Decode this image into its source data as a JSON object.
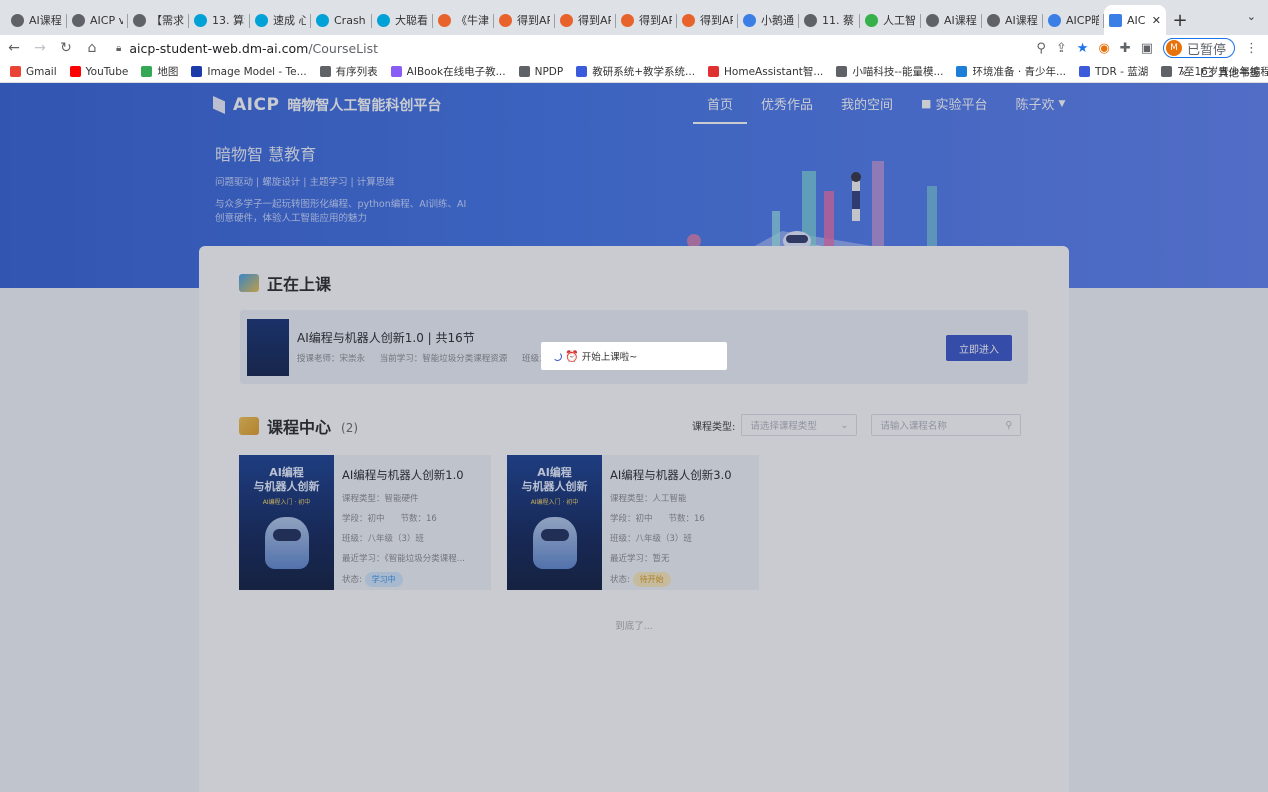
{
  "browser": {
    "tabs": [
      {
        "label": "AI课程",
        "color": "#5f6368"
      },
      {
        "label": "AICP v",
        "color": "#5f6368"
      },
      {
        "label": "【需求",
        "color": "#5f6368"
      },
      {
        "label": "13. 算法",
        "color": "#00a1d6"
      },
      {
        "label": "速成 心",
        "color": "#00a1d6"
      },
      {
        "label": "Crash C",
        "color": "#00a1d6"
      },
      {
        "label": "大聪看",
        "color": "#00a1d6"
      },
      {
        "label": "《牛津",
        "color": "#e8632c"
      },
      {
        "label": "得到AP",
        "color": "#e8632c"
      },
      {
        "label": "得到AP",
        "color": "#e8632c"
      },
      {
        "label": "得到AP",
        "color": "#e8632c"
      },
      {
        "label": "得到AP",
        "color": "#e8632c"
      },
      {
        "label": "小鹅通",
        "color": "#3b7ee6"
      },
      {
        "label": "11. 蔡",
        "color": "#5f6368"
      },
      {
        "label": "人工智",
        "color": "#35b04a"
      },
      {
        "label": "AI课程",
        "color": "#5f6368"
      },
      {
        "label": "AI课程",
        "color": "#5f6368"
      },
      {
        "label": "AICP暗",
        "color": "#3b7ee6"
      }
    ],
    "active_tab": {
      "label": "AIC",
      "close": "✕"
    },
    "new_tab": "+",
    "tab_menu": "⌄",
    "url_host": "aicp-student-web.dm-ai.com",
    "url_path": "/CourseList",
    "profile_initial": "M",
    "profile_label": "已暂停",
    "bookmarks": [
      {
        "label": "Gmail",
        "color": "#ea4335"
      },
      {
        "label": "YouTube",
        "color": "#ff0000"
      },
      {
        "label": "地图",
        "color": "#34a853"
      },
      {
        "label": "Image Model - Te...",
        "color": "#1a3ba8"
      },
      {
        "label": "有序列表",
        "color": "#5f6368"
      },
      {
        "label": "AIBook在线电子教...",
        "color": "#8a5cf6"
      },
      {
        "label": "NPDP",
        "color": "#5f6368"
      },
      {
        "label": "教研系统+教学系统...",
        "color": "#3b5bdb"
      },
      {
        "label": "HomeAssistant智...",
        "color": "#e03131"
      },
      {
        "label": "小喵科技--能量模...",
        "color": "#5f6368"
      },
      {
        "label": "环境准备 · 青少年...",
        "color": "#1c7ed6"
      },
      {
        "label": "TDR - 蓝湖",
        "color": "#3b5bdb"
      },
      {
        "label": "7至16岁青少年编程...",
        "color": "#5f6368"
      }
    ],
    "bookmarks_more": "»",
    "other_bookmarks": "其他书签"
  },
  "site": {
    "brand": "AICP",
    "brand_sub": "暗物智人工智能科创平台",
    "nav": [
      {
        "label": "首页",
        "active": true
      },
      {
        "label": "优秀作品",
        "active": false
      },
      {
        "label": "我的空间",
        "active": false
      },
      {
        "label": "实验平台",
        "active": false
      },
      {
        "label": "陈子欢",
        "active": false
      }
    ],
    "slogan": "暗物智 慧教育",
    "tags": "问题驱动 | 螺旋设计 | 主题学习 | 计算思维",
    "desc": "与众多学子一起玩转图形化编程、python编程、AI训练、AI创意硬件，体验人工智能应用的魅力"
  },
  "current": {
    "section_title": "正在上课",
    "course_name": "AI编程与机器人创新1.0 | 共16节",
    "teacher": "授课老师：宋崇永",
    "current_study": "当前学习：智能垃圾分类课程资源",
    "class_label": "班级：",
    "enter_button": "立即进入",
    "cover_text": "AI编程与机器人创新"
  },
  "course_center": {
    "section_title": "课程中心",
    "count": "(2)",
    "filter_label": "课程类型:",
    "type_placeholder": "请选择课程类型",
    "search_placeholder": "请输入课程名称",
    "end_text": "到底了...",
    "courses": [
      {
        "cover_title": "AI编程\n与机器人创新",
        "cover_sub": "AI编程入门 · 初中",
        "title": "AI编程与机器人创新1.0",
        "type": "课程类型：智能硬件",
        "school": "学段：初中",
        "lessons": "节数：16",
        "class": "班级：八年级（3）班",
        "recent": "最近学习：《智能垃圾分类课程...",
        "status_label": "状态:",
        "status": "学习中",
        "status_color": "#3a8ee6",
        "status_bg": "#cfe6fb"
      },
      {
        "cover_title": "AI编程\n与机器人创新",
        "cover_sub": "AI编程入门 · 初中",
        "title": "AI编程与机器人创新3.0",
        "type": "课程类型：人工智能",
        "school": "学段：初中",
        "lessons": "节数：16",
        "class": "班级：八年级（3）班",
        "recent": "最近学习：暂无",
        "status_label": "状态:",
        "status": "待开始",
        "status_color": "#d9960f",
        "status_bg": "#fbe9b8"
      }
    ]
  },
  "toast": {
    "icon": "alarm-clock",
    "text": "开始上课啦~"
  }
}
